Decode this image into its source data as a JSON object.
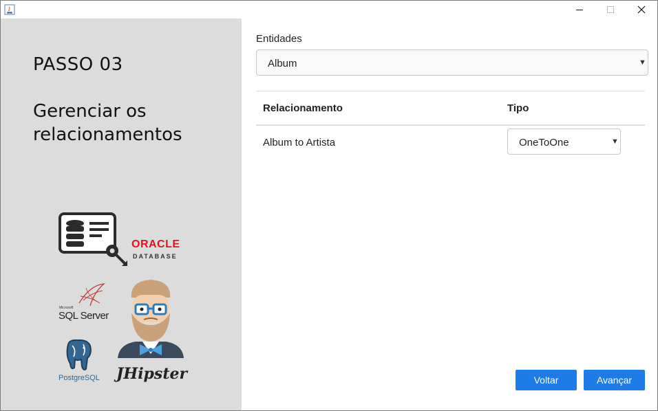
{
  "window": {
    "icons": {
      "app": "java-icon",
      "minimize": "minimize-icon",
      "maximize": "maximize-icon",
      "close": "close-icon"
    }
  },
  "sidebar": {
    "step_title": "PASSO 03",
    "step_description": "Gerenciar os relacionamentos",
    "logos": {
      "oracle_line1": "ORACLE",
      "oracle_line2": "DATABASE",
      "sqlserver_small": "Microsoft",
      "sqlserver": "SQL Server",
      "postgres": "PostgreSQL",
      "jhipster": "JHipster"
    }
  },
  "main": {
    "entities_label": "Entidades",
    "entity_selected": "Album",
    "table": {
      "headers": [
        "Relacionamento",
        "Tipo"
      ],
      "rows": [
        {
          "relationship": "Album to Artista",
          "type": "OneToOne"
        }
      ]
    }
  },
  "footer": {
    "back_label": "Voltar",
    "next_label": "Avançar"
  },
  "colors": {
    "sidebar_bg": "#dcdcdc",
    "button_bg": "#1e7ce8",
    "oracle_red": "#e0141e"
  }
}
